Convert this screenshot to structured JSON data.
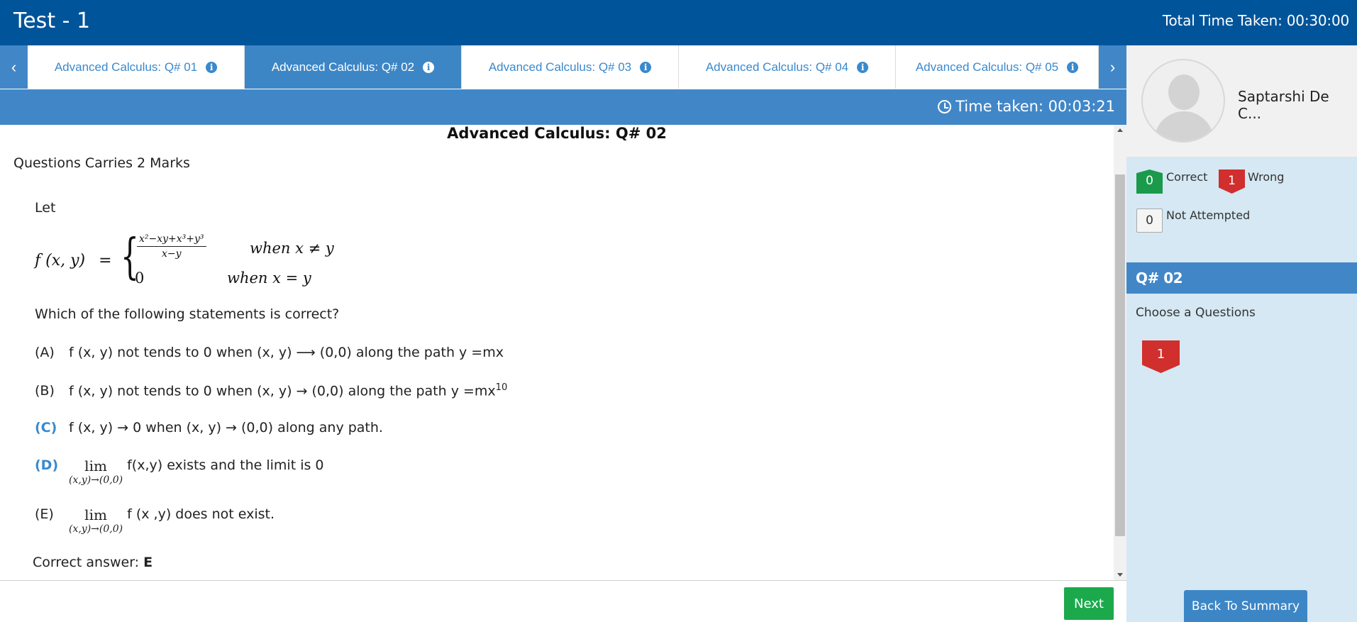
{
  "header": {
    "title": "Test - 1",
    "total_time": "Total Time Taken: 00:30:00"
  },
  "tabs": [
    {
      "label": "Advanced Calculus: Q# 01",
      "active": false
    },
    {
      "label": "Advanced Calculus: Q# 02",
      "active": true
    },
    {
      "label": "Advanced Calculus: Q# 03",
      "active": false
    },
    {
      "label": "Advanced Calculus: Q# 04",
      "active": false
    },
    {
      "label": "Advanced Calculus: Q# 05",
      "active": false
    }
  ],
  "time_taken": "Time taken: 00:03:21",
  "question": {
    "heading": "Advanced Calculus: Q# 02",
    "marks": "Questions Carries 2 Marks",
    "let": "Let",
    "function_lhs": "f (x, y)",
    "equals": "=",
    "case1_numerator": "x²−xy+x³+y³",
    "case1_denominator": "x−y",
    "case1_condition": "when x ≠ y",
    "case2_value": "0",
    "case2_condition": "when x = y",
    "prompt": "Which of the following statements is correct?",
    "options": [
      {
        "label": "(A)",
        "text": "f (x, y) not tends to 0 when (x, y) ⟶ (0,0) along the path y =mx",
        "correct": false
      },
      {
        "label": "(B)",
        "text": "f (x, y) not tends to 0 when (x, y) →  (0,0) along the path y =mx",
        "sup": "10",
        "correct": false
      },
      {
        "label": "(C)",
        "text": "f (x, y) → 0 when (x, y) → (0,0) along any path.",
        "correct": true
      },
      {
        "label": "(D)",
        "lim_top": "lim",
        "lim_bottom": "(x,y)→(0,0)",
        "text": "f(x,y)  exists and the limit is 0",
        "correct": true
      },
      {
        "label": "(E)",
        "lim_top": "lim",
        "lim_bottom": "(x,y)→(0,0)",
        "text": "f (x ,y)  does not exist.",
        "correct": false
      }
    ],
    "correct_answer_label": "Correct answer:",
    "correct_answer_value": "E"
  },
  "footer": {
    "next_label": "Next"
  },
  "sidebar": {
    "user_name": "Saptarshi De C...",
    "stats": {
      "correct_count": "0",
      "correct_label": "Correct",
      "wrong_count": "1",
      "wrong_label": "Wrong",
      "not_attempted_count": "0",
      "not_attempted_label": "Not Attempted"
    },
    "current_question": "Q# 02",
    "choose_label": "Choose a Questions",
    "question_badges": [
      "1"
    ],
    "back_label": "Back To Summary"
  },
  "colors": {
    "header_bg": "#00549a",
    "accent_blue": "#4187c8",
    "correct_green": "#1a9a4a",
    "wrong_red": "#d12e2e",
    "panel_bg": "#d5e8f3",
    "next_green": "#1ba94c"
  }
}
